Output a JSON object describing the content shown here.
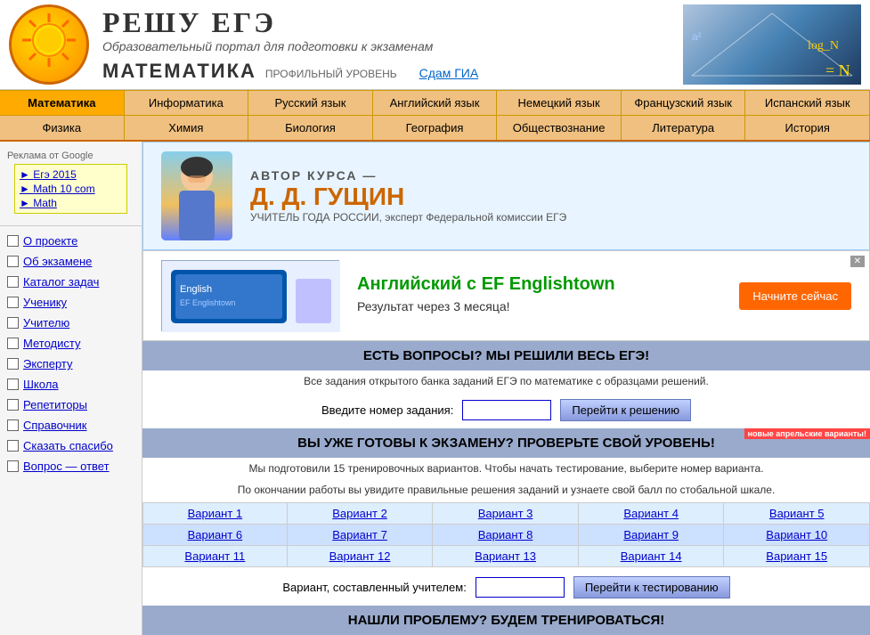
{
  "header": {
    "title": "РЕШУ ЕГЭ",
    "subtitle": "Образовательный портал для подготовки к экзаменам",
    "math_label": "МАТЕМАТИКА",
    "level_label": "ПРОФИЛЬНЫЙ УРОВЕНЬ",
    "goa_link": "Сдам ГИА"
  },
  "nav1": {
    "items": [
      "Математика",
      "Информатика",
      "Русский язык",
      "Английский язык",
      "Немецкий язык",
      "Французский язык",
      "Испанский язык"
    ]
  },
  "nav2": {
    "items": [
      "Физика",
      "Химия",
      "Биология",
      "География",
      "Обществознание",
      "Литература",
      "История"
    ]
  },
  "sidebar": {
    "ad_label": "Реклама от Google",
    "ad_links": [
      "Егэ 2015",
      "Math 10 com",
      "Math"
    ],
    "menu_items": [
      "О проекте",
      "Об экзамене",
      "Каталог задач",
      "Ученику",
      "Учителю",
      "Методисту",
      "Эксперту",
      "Школа",
      "Репетиторы",
      "Справочник",
      "Сказать спасибо",
      "Вопрос — ответ"
    ]
  },
  "author": {
    "label": "АВТОР КУРСА —",
    "name": "Д. Д. ГУЩИН",
    "title": "УЧИТЕЛЬ ГОДА РОССИИ, эксперт Федеральной комиссии ЕГЭ"
  },
  "ad": {
    "title": "Английский с EF Englishtown",
    "subtitle": "Результат через 3 месяца!",
    "button": "Начните сейчас"
  },
  "questions_section": {
    "header": "ЕСТЬ ВОПРОСЫ? МЫ РЕШИЛИ ВЕСЬ ЕГЭ!",
    "subtext": "Все задания открытого банка заданий ЕГЭ по математике с образцами решений.",
    "input_label": "Введите номер задания:",
    "button": "Перейти к решению"
  },
  "test_section": {
    "header": "ВЫ УЖЕ ГОТОВЫ К ЭКЗАМЕНУ? ПРОВЕРЬТЕ СВОЙ УРОВЕНЬ!",
    "badge": "новые апрельские варианты!",
    "subtext1": "Мы подготовили 15 тренировочных вариантов. Чтобы начать тестирование, выберите номер варианта.",
    "subtext2": "По окончании работы вы увидите правильные решения заданий и узнаете свой балл по стобальной шкале.",
    "variants": [
      [
        "Вариант 1",
        "Вариант 2",
        "Вариант 3",
        "Вариант 4",
        "Вариант 5"
      ],
      [
        "Вариант 6",
        "Вариант 7",
        "Вариант 8",
        "Вариант 9",
        "Вариант 10"
      ],
      [
        "Вариант 11",
        "Вариант 12",
        "Вариант 13",
        "Вариант 14",
        "Вариант 15"
      ]
    ],
    "teacher_label": "Вариант, составленный учителем:",
    "teacher_button": "Перейти к тестированию"
  },
  "problem_section": {
    "header": "НАШЛИ ПРОБЛЕМУ? БУДЕМ ТРЕНИРОВАТЬСЯ!"
  }
}
